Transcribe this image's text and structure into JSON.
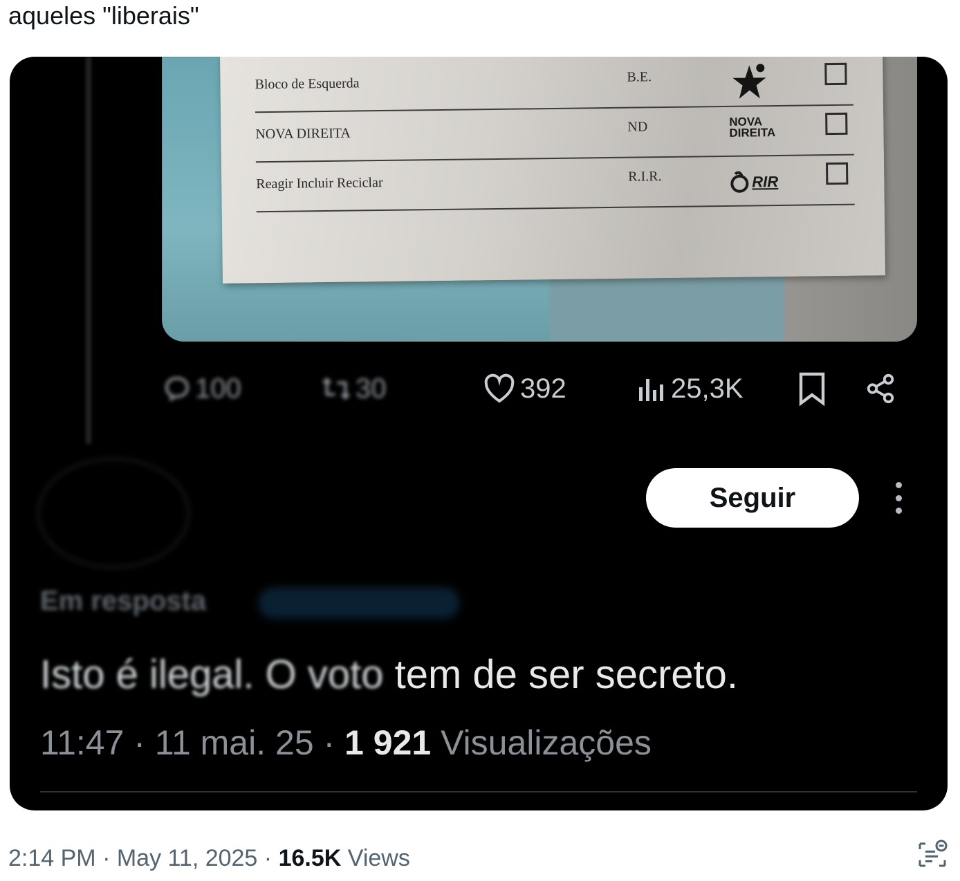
{
  "tweet": {
    "text": "aqueles \"liberais\"",
    "footer": {
      "time": "2:14 PM",
      "date": "May 11, 2025",
      "views_count": "16.5K",
      "views_label": "Views"
    }
  },
  "embedded": {
    "ballot": {
      "rows": [
        {
          "name": "Bloco de Esquerda",
          "abbr": "B.E.",
          "logo": "star-icon"
        },
        {
          "name": "NOVA DIREITA",
          "abbr": "ND",
          "logo": "NOVA DIREITA"
        },
        {
          "name": "Reagir Incluir Reciclar",
          "abbr": "R.I.R.",
          "logo": "RIR"
        }
      ]
    },
    "actions": {
      "replies": "100",
      "reposts": "30",
      "likes": "392",
      "views": "25,3K"
    },
    "follow_label": "Seguir",
    "reply_to_label": "Em resposta",
    "reply_text_blurred": "Isto é ilegal. O voto",
    "reply_text_clear": " tem de ser secreto.",
    "meta": {
      "time": "11:47",
      "date": "11 mai. 25",
      "views_count": "1 921",
      "views_label": "Visualizações"
    }
  },
  "colors": {
    "background": "#000000",
    "text_primary": "#e7e9ea",
    "text_secondary": "#8b9197",
    "button_bg": "#ffffff"
  }
}
